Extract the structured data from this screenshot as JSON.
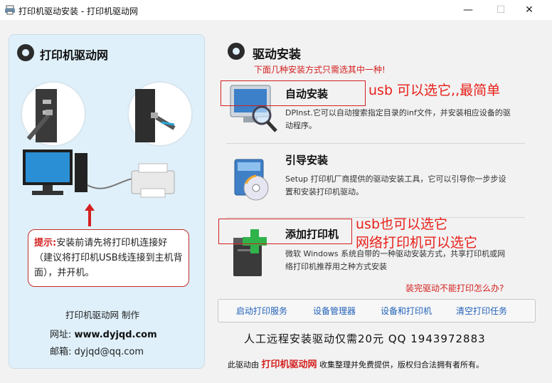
{
  "window": {
    "title": "打印机驱动安装 - 打印机驱动网",
    "minimize_glyph": "—",
    "maximize_glyph": "☐",
    "close_glyph": "✕"
  },
  "left_panel": {
    "heading": "打印机驱动网",
    "tip_label": "提示:",
    "tip_text": "安装前请先将打印机连接好（建议将打印机USB线连接到主机背面），并开机。",
    "maker": "打印机驱动网 制作",
    "website_label": "网址:",
    "website": "www.dyjqd.com",
    "email_label": "邮箱:",
    "email": "dyjqd@qq.com"
  },
  "right_panel": {
    "heading": "驱动安装",
    "subtitle": "下面几种安装方式只需选其中一种!",
    "options": [
      {
        "title": "自动安装",
        "desc": "DPInst.它可以自动搜索指定目录的inf文件，并安装相应设备的驱动程序。",
        "icon": "monitor-magnifier-icon"
      },
      {
        "title": "引导安装",
        "desc": "Setup 打印机厂商提供的驱动安装工具，它可以引导你一步步设置和安装打印机驱动。",
        "icon": "setup-disc-icon"
      },
      {
        "title": "添加打印机",
        "desc": "微软 Windows 系统自带的一种驱动安装方式，共享打印机或网络打印机推荐用之种方式安装",
        "icon": "add-printer-icon"
      }
    ],
    "help_link": "装完驱动不能打印怎么办?",
    "links": [
      "启动打印服务",
      "设备管理器",
      "设备和打印机",
      "清空打印任务"
    ],
    "remote_service": "人工远程安装驱动仅需20元 QQ 1943972883",
    "copyright_prefix": "此驱动由",
    "copyright_site": "打印机驱动网",
    "copyright_suffix": "收集整理并免费提供，版权归合法拥有者所有。"
  },
  "annotations": {
    "auto": "usb 可以选它,,最简单",
    "add_line1": "usb也可以选它",
    "add_line2": "网络打印机可以选它"
  },
  "colors": {
    "accent_red": "#d42020",
    "link_blue": "#2362b8",
    "panel_blue": "#dff0fa"
  }
}
